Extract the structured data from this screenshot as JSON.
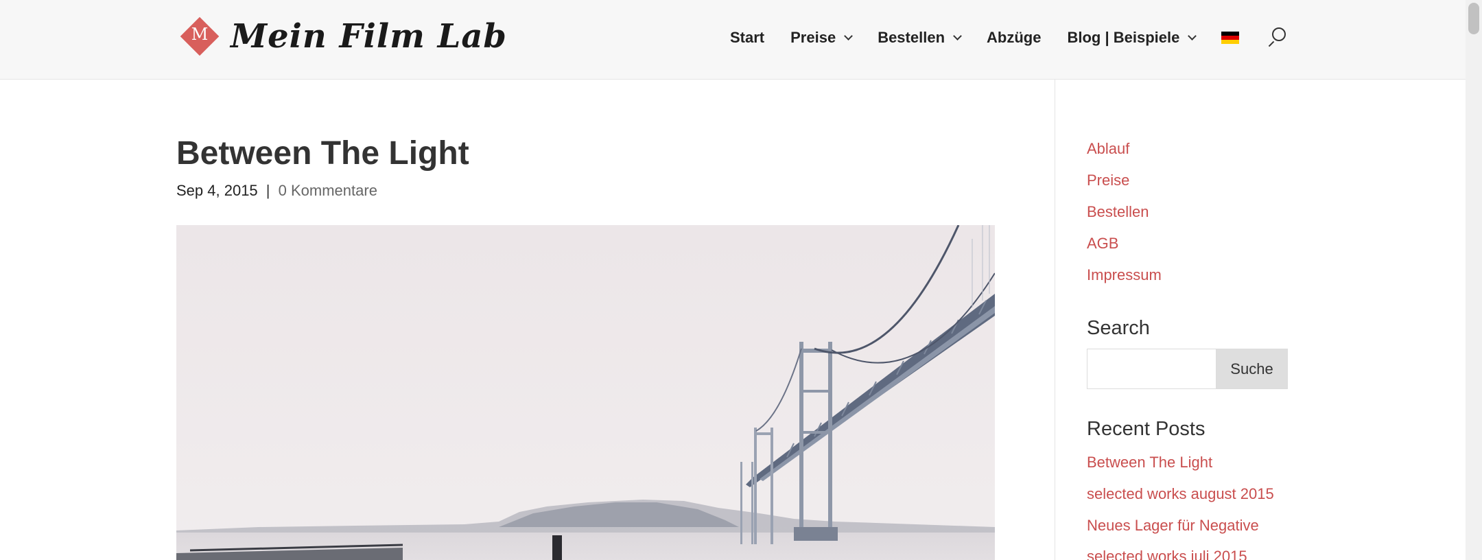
{
  "brand": {
    "name": "Mein Film Lab",
    "mark_letter": "M",
    "accent_color": "#d85f5c"
  },
  "nav": {
    "items": [
      {
        "label": "Start",
        "has_dropdown": false
      },
      {
        "label": "Preise",
        "has_dropdown": true
      },
      {
        "label": "Bestellen",
        "has_dropdown": true
      },
      {
        "label": "Abzüge",
        "has_dropdown": false
      },
      {
        "label": "Blog | Beispiele",
        "has_dropdown": true
      }
    ],
    "language_icon": "german-flag-icon",
    "search_icon": "search-icon"
  },
  "post": {
    "title": "Between The Light",
    "date": "Sep 4, 2015",
    "separator": "|",
    "comments": "0 Kommentare"
  },
  "sidebar": {
    "links": [
      "Ablauf",
      "Preise",
      "Bestellen",
      "AGB",
      "Impressum"
    ],
    "search": {
      "title": "Search",
      "button_label": "Suche",
      "value": ""
    },
    "recent_posts": {
      "title": "Recent Posts",
      "items": [
        "Between The Light",
        "selected works august 2015",
        "Neues Lager für Negative",
        "selected works juli 2015"
      ]
    },
    "link_color": "#c94e4e"
  }
}
